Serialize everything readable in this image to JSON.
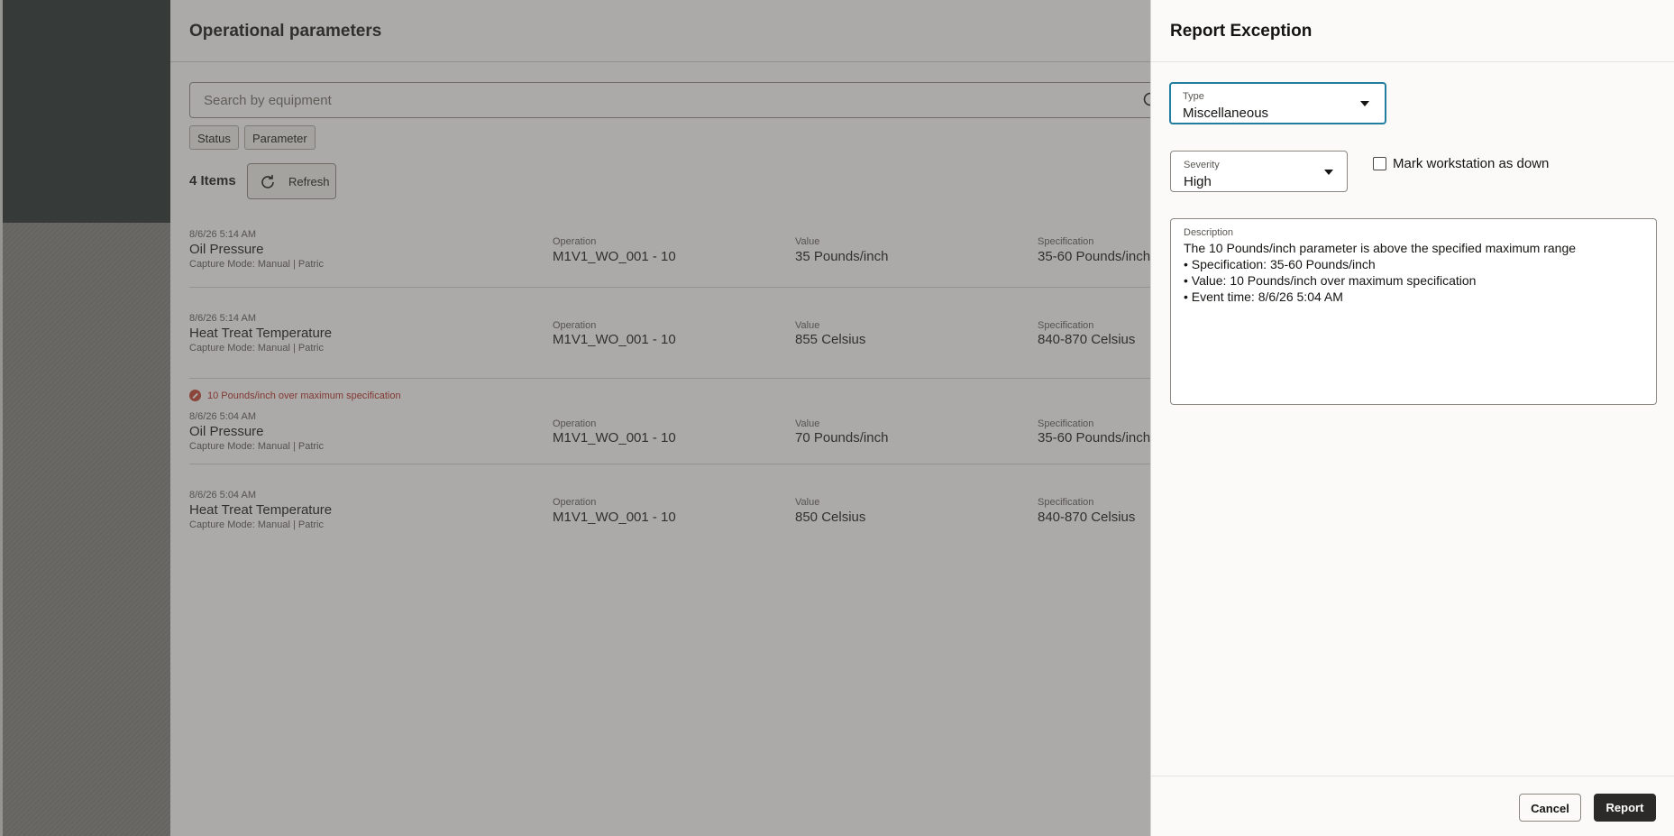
{
  "main": {
    "title": "Operational parameters",
    "search_placeholder": "Search by equipment",
    "filters": [
      "Status",
      "Parameter"
    ],
    "item_count": "4 Items",
    "refresh_label": "Refresh",
    "rows": [
      {
        "timestamp": "8/6/26 5:14 AM",
        "name": "Oil Pressure",
        "capture": "Capture Mode: Manual | Patric",
        "operation_label": "Operation",
        "operation": "M1V1_WO_001 - 10",
        "value_label": "Value",
        "value": "35 Pounds/inch",
        "spec_label": "Specification",
        "spec": "35-60 Pounds/inch",
        "error": ""
      },
      {
        "timestamp": "8/6/26 5:14 AM",
        "name": "Heat Treat Temperature",
        "capture": "Capture Mode: Manual | Patric",
        "operation_label": "Operation",
        "operation": "M1V1_WO_001 - 10",
        "value_label": "Value",
        "value": "855 Celsius",
        "spec_label": "Specification",
        "spec": "840-870 Celsius",
        "error": ""
      },
      {
        "timestamp": "8/6/26 5:04 AM",
        "name": "Oil Pressure",
        "capture": "Capture Mode: Manual | Patric",
        "operation_label": "Operation",
        "operation": "M1V1_WO_001 - 10",
        "value_label": "Value",
        "value": "70 Pounds/inch",
        "spec_label": "Specification",
        "spec": "35-60 Pounds/inch",
        "error": "10 Pounds/inch over maximum specification"
      },
      {
        "timestamp": "8/6/26 5:04 AM",
        "name": "Heat Treat Temperature",
        "capture": "Capture Mode: Manual | Patric",
        "operation_label": "Operation",
        "operation": "M1V1_WO_001 - 10",
        "value_label": "Value",
        "value": "850 Celsius",
        "spec_label": "Specification",
        "spec": "840-870 Celsius",
        "error": ""
      }
    ]
  },
  "drawer": {
    "title": "Report Exception",
    "type_label": "Type",
    "type_value": "Miscellaneous",
    "severity_label": "Severity",
    "severity_value": "High",
    "mark_down_label": "Mark workstation as down",
    "mark_down_checked": false,
    "description_label": "Description",
    "description_lines": [
      "The 10 Pounds/inch parameter is above the specified maximum range",
      "• Specification: 35-60 Pounds/inch",
      "• Value: 10 Pounds/inch over maximum specification",
      "• Event time: 8/6/26 5:04 AM"
    ],
    "cancel_label": "Cancel",
    "report_label": "Report"
  },
  "colors": {
    "focus_border": "#227e9e",
    "error_text": "#b3261e",
    "primary_button": "#2b2a28",
    "nav_dark": "#1f2b2b"
  },
  "icons": {
    "search": "search-icon",
    "refresh": "refresh-icon",
    "error": "error-icon",
    "dropdown": "caret-down-icon"
  }
}
